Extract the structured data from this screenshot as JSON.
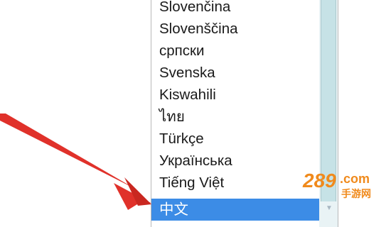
{
  "language_list": {
    "items": [
      {
        "label": "Slovenčina",
        "selected": false
      },
      {
        "label": "Slovenščina",
        "selected": false
      },
      {
        "label": "српски",
        "selected": false
      },
      {
        "label": "Svenska",
        "selected": false
      },
      {
        "label": "Kiswahili",
        "selected": false
      },
      {
        "label": "ไทย",
        "selected": false
      },
      {
        "label": "Türkçe",
        "selected": false
      },
      {
        "label": "Українська",
        "selected": false
      },
      {
        "label": "Tiếng Việt",
        "selected": false
      },
      {
        "label": "中文",
        "selected": true
      }
    ]
  },
  "watermark": {
    "text": "289.com",
    "subtext": "手游网"
  },
  "colors": {
    "selection": "#3c8ce6",
    "arrow": "#e0312a",
    "scrollbar_thumb": "#c6e2e6",
    "watermark_orange": "#f08a1c"
  },
  "icons": {
    "pointer": "red-arrow-icon",
    "dropdown": "chevron-down-icon"
  }
}
